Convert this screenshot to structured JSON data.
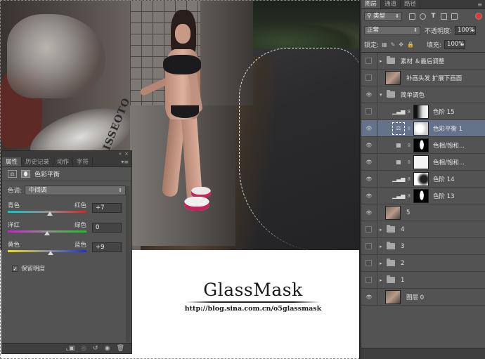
{
  "canvas": {
    "watermark_title": "GlassMask",
    "watermark_url": "http://blog.sina.com.cn/o5glassmask",
    "graffiti_text": "BALLISSEOTO"
  },
  "properties_panel": {
    "tabs": [
      {
        "label": "属性",
        "active": true
      },
      {
        "label": "历史记录",
        "active": false
      },
      {
        "label": "动作",
        "active": false
      },
      {
        "label": "字符",
        "active": false
      }
    ],
    "collapse_glyph": "«",
    "close_glyph": "×",
    "menu_glyph": "▾≡",
    "title": "色彩平衡",
    "tone_label": "色调:",
    "tone_value": "中间调",
    "sliders": [
      {
        "left": "青色",
        "right": "红色",
        "value": "+7",
        "level": 7
      },
      {
        "left": "洋红",
        "right": "绿色",
        "value": "0",
        "level": 0
      },
      {
        "left": "黄色",
        "right": "蓝色",
        "value": "+9",
        "level": 9
      }
    ],
    "preserve_luminosity": "保留明度",
    "preserve_checked": true,
    "footer_icons": [
      "clip-icon",
      "view-previous-icon",
      "reset-icon",
      "visibility-icon",
      "trash-icon"
    ]
  },
  "layers_panel": {
    "tabs": [
      {
        "label": "图层",
        "active": true
      },
      {
        "label": "通道",
        "active": false
      },
      {
        "label": "路径",
        "active": false
      }
    ],
    "menu_glyph": "≡",
    "filter_kind": "类型",
    "blend_mode": "正常",
    "opacity_label": "不透明度:",
    "opacity_value": "100%",
    "lock_label": "锁定:",
    "fill_label": "填充:",
    "fill_value": "100%",
    "layers": [
      {
        "name": "素材 ＆最后调整",
        "kind": "group",
        "visible": false,
        "expanded": false,
        "indent": 0
      },
      {
        "name": "补画头发 扩展下画面",
        "kind": "photo",
        "visible": false,
        "indent": 0
      },
      {
        "name": "简单调色",
        "kind": "group",
        "visible": true,
        "expanded": true,
        "indent": 0
      },
      {
        "name": "色阶 15",
        "kind": "levels",
        "visible": false,
        "indent": 1,
        "mask": "dark-white"
      },
      {
        "name": "色彩平衡 1",
        "kind": "color-balance",
        "visible": true,
        "indent": 1,
        "mask": "light",
        "selected": true
      },
      {
        "name": "色相/饱和...",
        "kind": "hue-sat",
        "visible": true,
        "indent": 1,
        "mask": "black-figure"
      },
      {
        "name": "色相/饱和...",
        "kind": "hue-sat",
        "visible": true,
        "indent": 1,
        "mask": "white"
      },
      {
        "name": "色阶 14",
        "kind": "levels",
        "visible": true,
        "indent": 1,
        "mask": "white-dark"
      },
      {
        "name": "色阶 13",
        "kind": "levels",
        "visible": true,
        "indent": 1,
        "mask": "black-figure"
      },
      {
        "name": "5",
        "kind": "photo",
        "visible": true,
        "indent": 0
      },
      {
        "name": "4",
        "kind": "group",
        "visible": false,
        "expanded": false,
        "indent": 0
      },
      {
        "name": "3",
        "kind": "group",
        "visible": false,
        "expanded": false,
        "indent": 0
      },
      {
        "name": "2",
        "kind": "group",
        "visible": false,
        "expanded": false,
        "indent": 0
      },
      {
        "name": "1",
        "kind": "group",
        "visible": false,
        "expanded": false,
        "indent": 0
      },
      {
        "name": "图层 0",
        "kind": "photo",
        "visible": true,
        "indent": 0
      }
    ]
  }
}
